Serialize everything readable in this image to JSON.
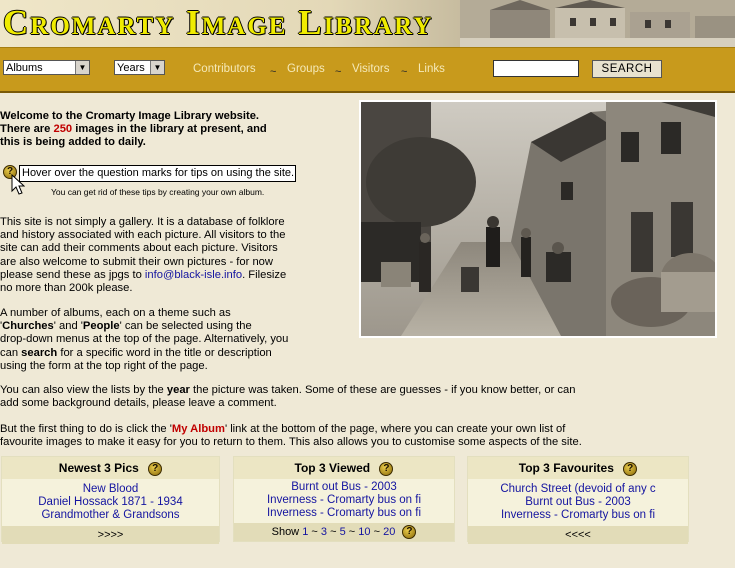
{
  "site": {
    "title": "Cromarty Image Library"
  },
  "nav": {
    "albums_select": "Albums",
    "years_select": "Years",
    "links": [
      "Contributors",
      "Groups",
      "Visitors",
      "Links"
    ],
    "separator": "~",
    "search_button": "SEARCH",
    "search_value": ""
  },
  "intro": {
    "line1": "Welcome to the Cromarty Image Library website.",
    "line2a": "There are ",
    "count": "250",
    "line2b": " images in the library at present, and",
    "line3": "this is being added to daily."
  },
  "tip": {
    "icon": "?",
    "box": "Hover over the question marks for tips on using the site.",
    "note": "You can get rid of these tips by creating your own album."
  },
  "para1": {
    "l1": "This site is not simply a gallery. It is a database of folklore",
    "l2": "and history associated with each picture. All visitors to the",
    "l3": "site can add their comments about each picture. Visitors",
    "l4": "are also welcome to submit their own pictures - for now",
    "l5a": "please send these as jpgs to ",
    "email": "info@black-isle.info",
    "l5b": ". Filesize",
    "l6": "no more than 200k please."
  },
  "para2": {
    "l1": "A number of albums, each on a theme such as",
    "l2_churches": "Churches",
    "l2_and": "' and '",
    "l2_people": "People",
    "l2_rest": "' can be selected using the",
    "l3": "drop-down menus at the top of the page. Alternatively, you",
    "l4a": "can ",
    "search": "search",
    "l4b": " for a specific word in the title or description",
    "l5": "using the form at the top right of the page."
  },
  "para3": {
    "l1a": "You can also view the lists by the ",
    "year": "year",
    "l1b": " the picture was taken. Some of these are guesses - if you know better, or can",
    "l2": "add some background details, please leave a comment."
  },
  "para4": {
    "l1a": "But the first thing to do is click the '",
    "myalbum": "My Album",
    "l1b": "' link at the bottom of the page, where you can create your own list of",
    "l2": "favourite images to make it easy for you to return to them. This also allows you to customise some aspects of the site."
  },
  "panels": {
    "newest": {
      "title": "Newest 3 Pics",
      "items": [
        "New Blood",
        "Daniel Hossack 1871 - 1934",
        "Grandmother & Grandsons"
      ],
      "foot": ">>>>"
    },
    "viewed": {
      "title": "Top 3 Viewed",
      "items": [
        "Burnt out Bus - 2003",
        "Inverness - Cromarty bus on fi",
        "Inverness - Cromarty bus on fi"
      ],
      "show_label": "Show",
      "show_options": [
        "1",
        "3",
        "5",
        "10",
        "20"
      ]
    },
    "favourites": {
      "title": "Top 3 Favourites",
      "items": [
        "Church Street (devoid of any c",
        "Burnt out Bus - 2003",
        "Inverness - Cromarty bus on fi"
      ],
      "foot": "<<<<"
    }
  },
  "colors": {
    "accent_red": "#c00000",
    "link_blue": "#1414a0",
    "nav_bar": "#c89a1c",
    "title_yellow": "#f0ec00"
  }
}
